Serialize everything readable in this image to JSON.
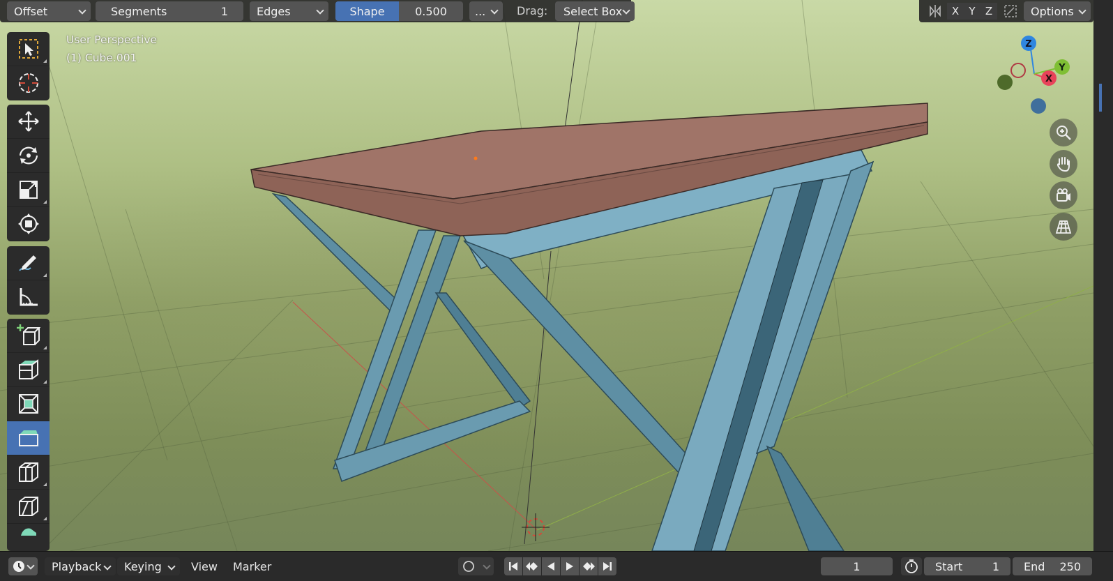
{
  "header": {
    "mode_dropdown": "Offset",
    "segments": {
      "label": "Segments",
      "value": "1"
    },
    "affect_dropdown": "Edges",
    "shape": {
      "label": "Shape",
      "value": "0.500"
    },
    "more_dropdown": "...",
    "drag_label": "Drag:",
    "drag_dropdown": "Select Box",
    "axes": [
      "X",
      "Y",
      "Z"
    ],
    "options_dropdown": "Options"
  },
  "viewport": {
    "perspective_label": "User Perspective",
    "object_label": "(1) Cube.001"
  },
  "toolbar": {
    "tools": [
      "select-box-tool",
      "cursor-tool",
      "move-tool",
      "rotate-tool",
      "scale-tool",
      "transform-tool",
      "annotate-tool",
      "measure-tool",
      "add-cube-tool",
      "extrude-region-tool",
      "inset-faces-tool",
      "bevel-tool",
      "loop-cut-tool",
      "knife-tool"
    ],
    "active_tool": "bevel-tool"
  },
  "gizmo": {
    "x": "X",
    "y": "Y",
    "z": "Z"
  },
  "timeline": {
    "menus": [
      "Playback",
      "Keying",
      "View",
      "Marker"
    ],
    "current_frame": "1",
    "start_label": "Start",
    "start_value": "1",
    "end_label": "End",
    "end_value": "250"
  },
  "colors": {
    "accent": "#4772b3",
    "tabletop": "#9c7066",
    "frame": "#6a9bb0",
    "axis_x": "#e8435a",
    "axis_y": "#7fbf34",
    "axis_z": "#2f86e0"
  }
}
